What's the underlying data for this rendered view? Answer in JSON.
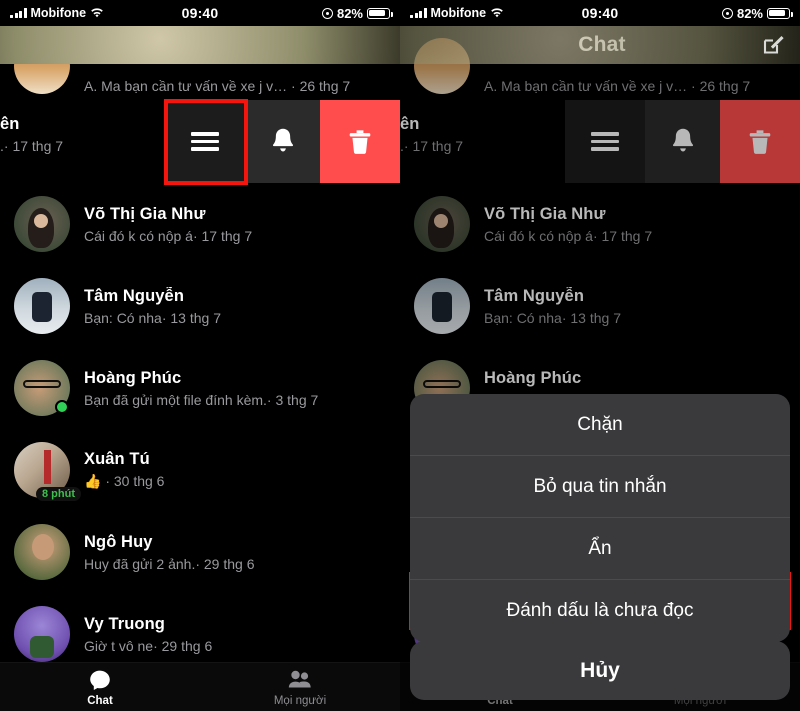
{
  "status_bar": {
    "carrier": "Mobifone",
    "time": "09:40",
    "battery": "82%"
  },
  "nav": {
    "title": "Chat",
    "compose_icon": "compose-icon",
    "avatar_icon": "profile-avatar"
  },
  "swipe_actions": {
    "more_icon": "hamburger-menu-icon",
    "mute_icon": "bell-icon",
    "delete_icon": "trash-icon",
    "delete_color": "#ff4d4d",
    "highlight_color": "#f4150f"
  },
  "conversations": [
    {
      "name": "",
      "snippet": "A. Ma bạn cần tư vấn về xe j v…  · 26 thg 7",
      "clipped": true
    },
    {
      "name": "ên",
      "snippet": ".· 17 thg 7",
      "clipped": true
    },
    {
      "name": "Võ Thị Gia Như",
      "snippet": "Cái đó k có nộp á· 17 thg 7"
    },
    {
      "name": "Tâm Nguyễn",
      "snippet": "Bạn: Có nha· 13 thg 7"
    },
    {
      "name": "Hoàng Phúc",
      "snippet": "Bạn đã gửi một file đính kèm.· 3 thg 7",
      "online": true
    },
    {
      "name": "Xuân Tú",
      "snippet": "👍 · 30 thg 6",
      "badge": "8 phút"
    },
    {
      "name": "Ngô Huy",
      "snippet": "Huy đã gửi 2 ảnh.· 29 thg 6"
    },
    {
      "name": "Vy Truong",
      "snippet": "Giờ t vô ne· 29 thg 6"
    }
  ],
  "tabbar": {
    "tabs": [
      {
        "label": "Chat",
        "icon": "chat-bubble-icon",
        "active": true
      },
      {
        "label": "Mọi người",
        "icon": "people-icon",
        "active": false
      }
    ]
  },
  "action_sheet": {
    "items": [
      {
        "label": "Chặn",
        "highlighted": false
      },
      {
        "label": "Bỏ qua tin nhắn",
        "highlighted": false
      },
      {
        "label": "Ẩn",
        "highlighted": false
      },
      {
        "label": "Đánh dấu là chưa đọc",
        "highlighted": true
      }
    ],
    "cancel_label": "Hủy"
  }
}
